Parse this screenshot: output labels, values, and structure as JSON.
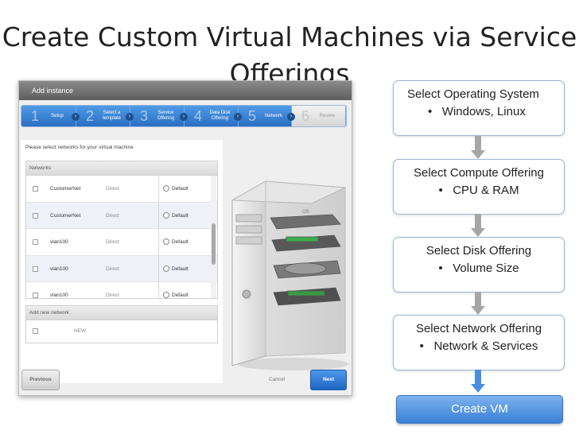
{
  "slide": {
    "title": "Create Custom Virtual Machines via Service Offerings"
  },
  "dialog": {
    "title": "Add instance",
    "steps": [
      {
        "num": "1",
        "label": "Setup",
        "active": true
      },
      {
        "num": "2",
        "label": "Select a template",
        "active": true
      },
      {
        "num": "3",
        "label": "Service Offering",
        "active": true
      },
      {
        "num": "4",
        "label": "Data Disk Offering",
        "active": true
      },
      {
        "num": "5",
        "label": "Network",
        "active": true
      },
      {
        "num": "6",
        "label": "Review",
        "active": false
      }
    ],
    "instruction": "Please select networks for your virtual machine",
    "networks_header": "Networks",
    "networks": [
      {
        "name": "CustomerNet",
        "type": "Direct",
        "default_label": "Default"
      },
      {
        "name": "CustomerNet",
        "type": "Direct",
        "default_label": "Default"
      },
      {
        "name": "vlan100",
        "type": "Direct",
        "default_label": "Default"
      },
      {
        "name": "vlan100",
        "type": "Direct",
        "default_label": "Default"
      },
      {
        "name": "vlan100",
        "type": "Direct",
        "default_label": "Default"
      }
    ],
    "add_network_header": "Add new network",
    "new_label": "NEW",
    "previous_label": "Previous",
    "cancel_label": "Cancel",
    "next_label": "Next"
  },
  "flow": {
    "steps": [
      {
        "title": "Select Operating System",
        "bullet": "Windows, Linux"
      },
      {
        "title": "Select Compute Offering",
        "bullet": "CPU & RAM"
      },
      {
        "title": "Select Disk Offering",
        "bullet": "Volume Size"
      },
      {
        "title": "Select Network Offering",
        "bullet": "Network & Services"
      }
    ],
    "bullet_char": "•",
    "final": "Create VM"
  },
  "colors": {
    "accent_blue": "#2a6fc3",
    "arrow_gray": "#a6a6a6",
    "arrow_blue": "#4a8ee0",
    "box_border": "#9cb5d9"
  },
  "icons": {
    "step_chevron": "chevron-right-icon",
    "checkbox": "checkbox-icon",
    "radio": "radio-icon",
    "server": "server-tower-icon",
    "flow_arrow": "arrow-down-icon"
  }
}
